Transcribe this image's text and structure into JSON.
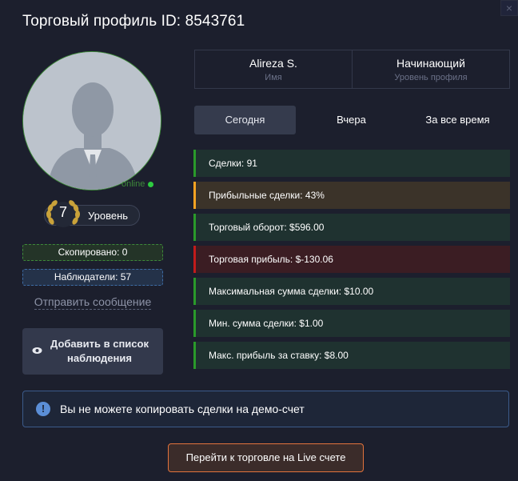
{
  "header": {
    "title": "Торговый профиль ID: 8543761",
    "close_glyph": "×"
  },
  "profile": {
    "status": "online",
    "level_number": "7",
    "level_label": "Уровень",
    "copied": "Скопировано: 0",
    "watchers": "Наблюдатели: 57",
    "send_message": "Отправить сообщение",
    "add_watch_icon": "eye-icon",
    "add_watch": "Добавить в список наблюдения"
  },
  "info": {
    "name_value": "Alireza S.",
    "name_label": "Имя",
    "level_value": "Начинающий",
    "level_label": "Уровень профиля"
  },
  "tabs": [
    {
      "label": "Сегодня",
      "active": true
    },
    {
      "label": "Вчера",
      "active": false
    },
    {
      "label": "За все время",
      "active": false
    }
  ],
  "stats": [
    {
      "text": "Сделки: 91",
      "status": "green"
    },
    {
      "text": "Прибыльные сделки: 43%",
      "status": "orange"
    },
    {
      "text": "Торговый оборот: $596.00",
      "status": "green"
    },
    {
      "text": "Торговая прибыль: $-130.06",
      "status": "red"
    },
    {
      "text": "Максимальная сумма сделки: $10.00",
      "status": "green"
    },
    {
      "text": "Мин. сумма сделки: $1.00",
      "status": "green"
    },
    {
      "text": "Макс. прибыль за ставку: $8.00",
      "status": "green"
    }
  ],
  "alert": {
    "icon": "info-icon",
    "text": "Вы не можете копировать сделки на демо-счет"
  },
  "live_button": "Перейти к торговле на Live счете",
  "colors": {
    "background": "#1c1f2d",
    "green": "#2a9a2a",
    "orange": "#f6a322",
    "red": "#c21b1b",
    "accent_orange": "#e2733c"
  }
}
